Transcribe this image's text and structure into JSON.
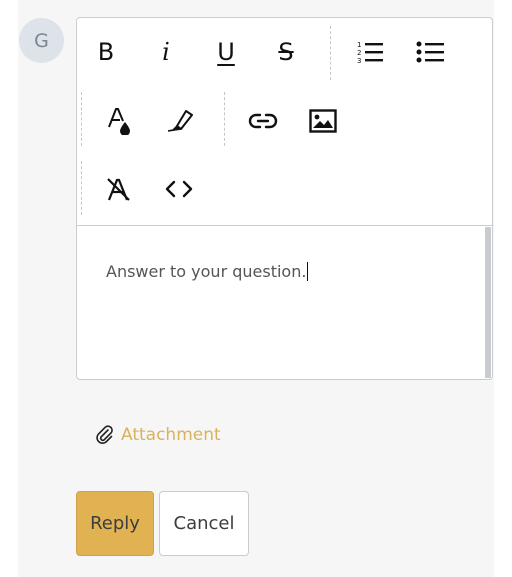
{
  "avatar": {
    "initial": "G"
  },
  "toolbar": {
    "bold": "B",
    "italic": "i",
    "underline": "U",
    "strikethrough": "S",
    "icons": [
      "bold-icon",
      "italic-icon",
      "underline-icon",
      "strikethrough-icon",
      "ordered-list-icon",
      "unordered-list-icon",
      "text-color-icon",
      "highlight-icon",
      "link-icon",
      "image-icon",
      "clear-format-icon",
      "code-icon"
    ]
  },
  "editor": {
    "content": "Answer to your question."
  },
  "attachment": {
    "label": "Attachment"
  },
  "actions": {
    "reply": "Reply",
    "cancel": "Cancel"
  },
  "colors": {
    "accent": "#e0b252",
    "attachment_text": "#d9b25b",
    "panel_bg": "#f6f6f6"
  }
}
